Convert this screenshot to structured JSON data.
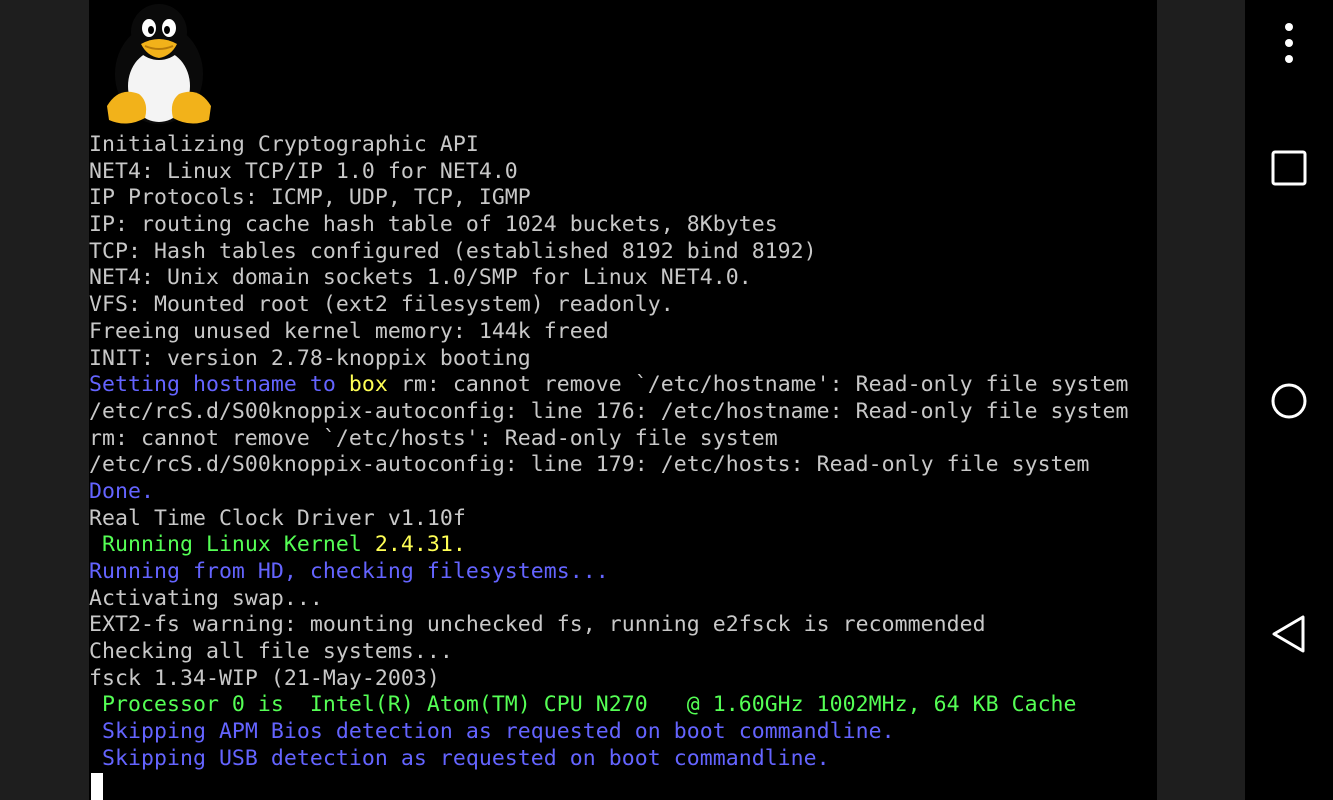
{
  "terminal": {
    "lines": [
      [
        {
          "text": "Initializing Cryptographic API",
          "color": "default"
        }
      ],
      [
        {
          "text": "NET4: Linux TCP/IP 1.0 for NET4.0",
          "color": "default"
        }
      ],
      [
        {
          "text": "IP Protocols: ICMP, UDP, TCP, IGMP",
          "color": "default"
        }
      ],
      [
        {
          "text": "IP: routing cache hash table of 1024 buckets, 8Kbytes",
          "color": "default"
        }
      ],
      [
        {
          "text": "TCP: Hash tables configured (established 8192 bind 8192)",
          "color": "default"
        }
      ],
      [
        {
          "text": "NET4: Unix domain sockets 1.0/SMP for Linux NET4.0.",
          "color": "default"
        }
      ],
      [
        {
          "text": "VFS: Mounted root (ext2 filesystem) readonly.",
          "color": "default"
        }
      ],
      [
        {
          "text": "Freeing unused kernel memory: 144k freed",
          "color": "default"
        }
      ],
      [
        {
          "text": "INIT: version 2.78-knoppix booting",
          "color": "default"
        }
      ],
      [
        {
          "text": "Setting hostname to ",
          "color": "blue"
        },
        {
          "text": "box",
          "color": "yellow"
        },
        {
          "text": " rm: cannot remove `/etc/hostname': Read-only file system",
          "color": "default"
        }
      ],
      [
        {
          "text": "/etc/rcS.d/S00knoppix-autoconfig: line 176: /etc/hostname: Read-only file system",
          "color": "default"
        }
      ],
      [
        {
          "text": "rm: cannot remove `/etc/hosts': Read-only file system",
          "color": "default"
        }
      ],
      [
        {
          "text": "/etc/rcS.d/S00knoppix-autoconfig: line 179: /etc/hosts: Read-only file system",
          "color": "default"
        }
      ],
      [
        {
          "text": "Done.",
          "color": "blue"
        }
      ],
      [
        {
          "text": "Real Time Clock Driver v1.10f",
          "color": "default"
        }
      ],
      [
        {
          "text": " Running Linux Kernel ",
          "color": "green"
        },
        {
          "text": "2.4.31.",
          "color": "yellow"
        }
      ],
      [
        {
          "text": "Running from HD, checking filesystems...",
          "color": "blue"
        }
      ],
      [
        {
          "text": "Activating swap...",
          "color": "default"
        }
      ],
      [
        {
          "text": "EXT2-fs warning: mounting unchecked fs, running e2fsck is recommended",
          "color": "default"
        }
      ],
      [
        {
          "text": "Checking all file systems...",
          "color": "default"
        }
      ],
      [
        {
          "text": "fsck 1.34-WIP (21-May-2003)",
          "color": "default"
        }
      ],
      [
        {
          "text": " Processor 0 is  Intel(R) Atom(TM) CPU N270   @ 1.60GHz 1002MHz, 64 KB Cache",
          "color": "green"
        }
      ],
      [
        {
          "text": " Skipping APM Bios detection as requested on boot commandline.",
          "color": "blue"
        }
      ],
      [
        {
          "text": " Skipping USB detection as requested on boot commandline.",
          "color": "blue"
        }
      ]
    ]
  },
  "colors": {
    "default": "#c8c8c8",
    "blue": "#6464ff",
    "yellow": "#ffff55",
    "green": "#55ff55",
    "background": "#000000",
    "frame": "#1e1e1e"
  },
  "logo": {
    "icon": "tux-penguin-icon"
  },
  "navbar": {
    "buttons": [
      {
        "name": "overflow-menu-button",
        "icon": "vertical-dots-icon"
      },
      {
        "name": "recents-button",
        "icon": "square-icon"
      },
      {
        "name": "home-button",
        "icon": "circle-icon"
      },
      {
        "name": "back-button",
        "icon": "triangle-back-icon"
      }
    ]
  }
}
